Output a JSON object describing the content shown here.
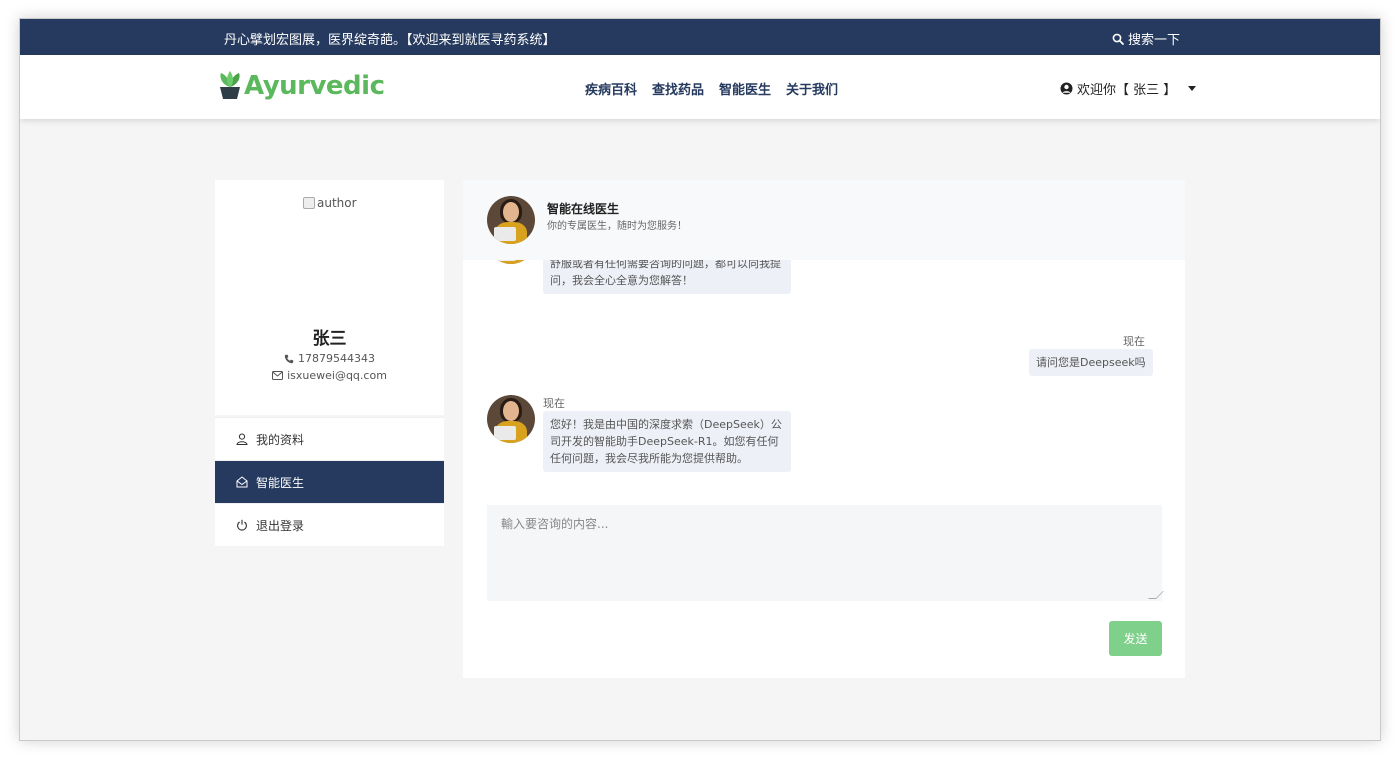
{
  "topbar": {
    "slogan": "丹心擘划宏图展，医界绽奇葩。【欢迎来到就医寻药系统】",
    "search_label": "搜索一下",
    "search_icon": "search-icon"
  },
  "header": {
    "logo_text": "Ayurvedic",
    "nav": [
      {
        "label": "疾病百科"
      },
      {
        "label": "查找药品"
      },
      {
        "label": "智能医生"
      },
      {
        "label": "关于我们"
      }
    ],
    "user_greeting": "欢迎你【 张三 】"
  },
  "profile": {
    "avatar_alt": "author",
    "name": "张三",
    "phone": "17879544343",
    "email": "isxuewei@qq.com"
  },
  "sidebar_menu": [
    {
      "label": "我的资料",
      "icon": "user-icon",
      "active": false
    },
    {
      "label": "智能医生",
      "icon": "envelope-open-icon",
      "active": true
    },
    {
      "label": "退出登录",
      "icon": "power-icon",
      "active": false
    }
  ],
  "chat": {
    "doctor_name": "智能在线医生",
    "doctor_subtitle": "你的专属医生，随时为您服务！",
    "messages": [
      {
        "side": "left",
        "time": "",
        "text": "舒服或者有任何需要咨询的问题，都可以向我提问，我会全心全意为您解答！"
      },
      {
        "side": "right",
        "time": "现在",
        "text": "请问您是Deepseek吗"
      },
      {
        "side": "left",
        "time": "现在",
        "text": "您好！我是由中国的深度求索（DeepSeek）公司开发的智能助手DeepSeek-R1。如您有任何任何问题，我会尽我所能为您提供帮助。"
      }
    ],
    "input_placeholder": "輸入要咨询的内容...",
    "send_label": "发送"
  },
  "colors": {
    "primary": "#253a5e",
    "logo_green": "#5cb85c",
    "send_green": "#7ed08a",
    "bubble_bg": "#eef0f7"
  }
}
